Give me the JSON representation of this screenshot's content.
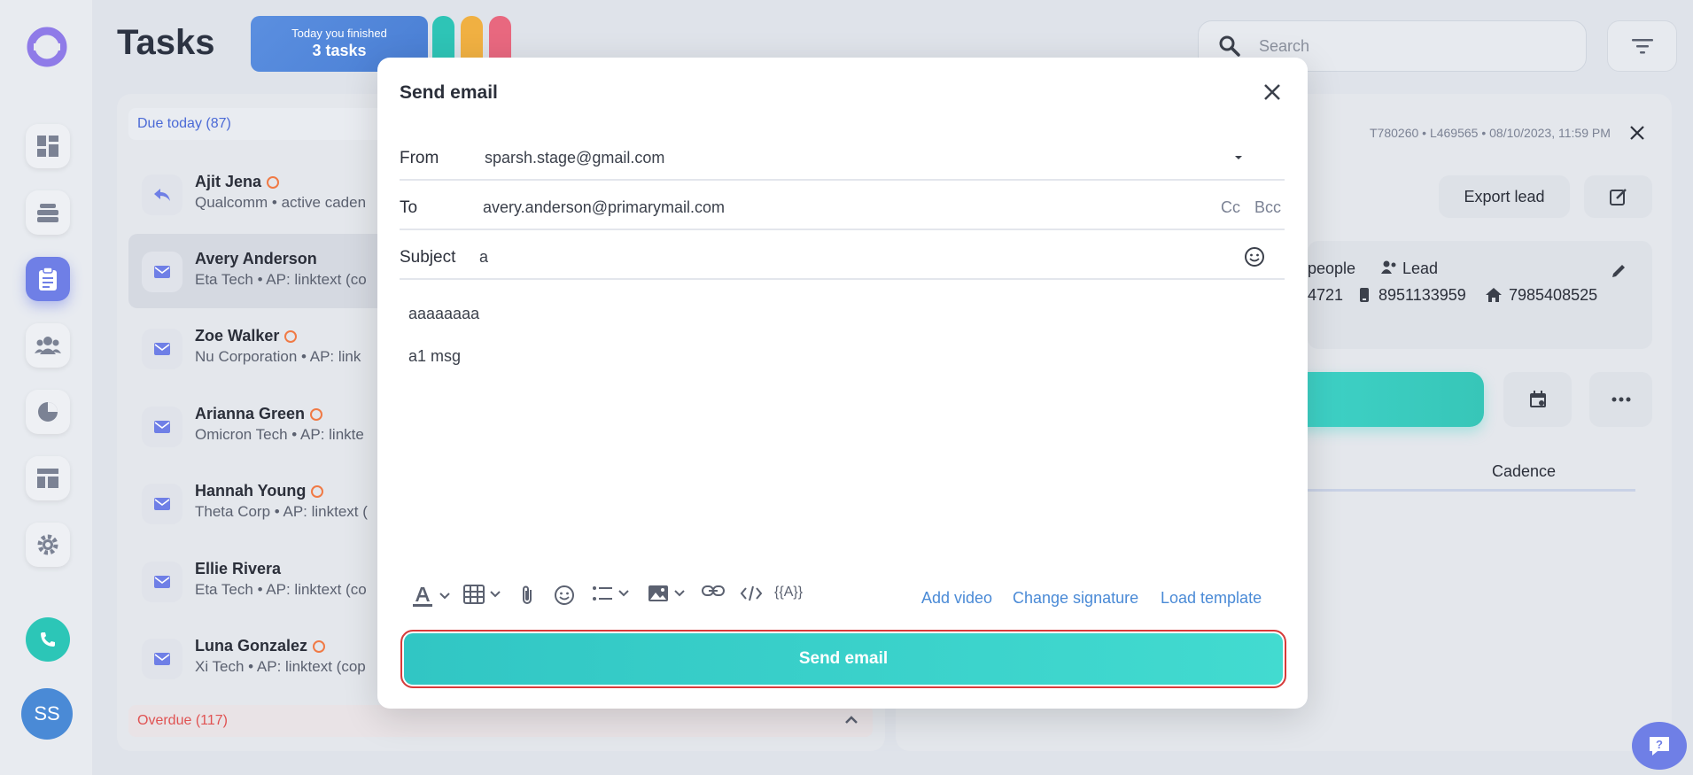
{
  "header": {
    "title": "Tasks",
    "today_label": "Today you finished",
    "today_count": "3 tasks",
    "search_placeholder": "Search"
  },
  "sidebar": {
    "avatar_initials": "SS"
  },
  "tasks": {
    "due_today_label": "Due today (87)",
    "overdue_label": "Overdue (117)",
    "items": [
      {
        "name": "Ajit Jena",
        "sub": "Qualcomm • active caden"
      },
      {
        "name": "Avery Anderson",
        "sub": "Eta Tech • AP: linktext (co"
      },
      {
        "name": "Zoe Walker",
        "sub": "Nu Corporation • AP: link"
      },
      {
        "name": "Arianna Green",
        "sub": "Omicron Tech • AP: linkte"
      },
      {
        "name": "Hannah Young",
        "sub": "Theta Corp • AP: linktext ("
      },
      {
        "name": "Ellie Rivera",
        "sub": "Eta Tech • AP: linktext (co"
      },
      {
        "name": "Luna Gonzalez",
        "sub": "Xi Tech • AP: linktext (cop"
      }
    ]
  },
  "lead": {
    "meta": "T780260 • L469565 • 08/10/2023, 11:59 PM",
    "export_label": "Export lead",
    "people_label": "people",
    "lead_label": "Lead",
    "phone_partial": "4721",
    "mobile": "8951133959",
    "home": "7985408525",
    "cadence_tab": "Cadence"
  },
  "modal": {
    "title": "Send email",
    "from_label": "From",
    "from_value": "sparsh.stage@gmail.com",
    "to_label": "To",
    "to_value": "avery.anderson@primarymail.com",
    "cc_label": "Cc",
    "bcc_label": "Bcc",
    "subject_label": "Subject",
    "subject_value": "a",
    "body_line1": "aaaaaaaa",
    "body_line2": "a1 msg",
    "variable_label": "{{A}}",
    "add_video": "Add video",
    "change_signature": "Change signature",
    "load_template": "Load template",
    "send_label": "Send email"
  },
  "colors": {
    "accent": "#6f7fe6",
    "teal": "#3fd3c8",
    "link": "#4a8ad6",
    "danger": "#e54848"
  }
}
